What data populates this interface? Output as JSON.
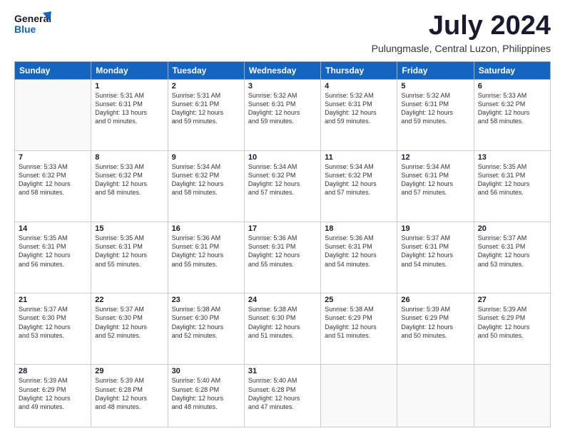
{
  "logo": {
    "line1": "General",
    "line2": "Blue"
  },
  "title": "July 2024",
  "location": "Pulungmasle, Central Luzon, Philippines",
  "weekdays": [
    "Sunday",
    "Monday",
    "Tuesday",
    "Wednesday",
    "Thursday",
    "Friday",
    "Saturday"
  ],
  "weeks": [
    [
      {
        "day": "",
        "info": ""
      },
      {
        "day": "1",
        "info": "Sunrise: 5:31 AM\nSunset: 6:31 PM\nDaylight: 13 hours\nand 0 minutes."
      },
      {
        "day": "2",
        "info": "Sunrise: 5:31 AM\nSunset: 6:31 PM\nDaylight: 12 hours\nand 59 minutes."
      },
      {
        "day": "3",
        "info": "Sunrise: 5:32 AM\nSunset: 6:31 PM\nDaylight: 12 hours\nand 59 minutes."
      },
      {
        "day": "4",
        "info": "Sunrise: 5:32 AM\nSunset: 6:31 PM\nDaylight: 12 hours\nand 59 minutes."
      },
      {
        "day": "5",
        "info": "Sunrise: 5:32 AM\nSunset: 6:31 PM\nDaylight: 12 hours\nand 59 minutes."
      },
      {
        "day": "6",
        "info": "Sunrise: 5:33 AM\nSunset: 6:32 PM\nDaylight: 12 hours\nand 58 minutes."
      }
    ],
    [
      {
        "day": "7",
        "info": "Sunrise: 5:33 AM\nSunset: 6:32 PM\nDaylight: 12 hours\nand 58 minutes."
      },
      {
        "day": "8",
        "info": "Sunrise: 5:33 AM\nSunset: 6:32 PM\nDaylight: 12 hours\nand 58 minutes."
      },
      {
        "day": "9",
        "info": "Sunrise: 5:34 AM\nSunset: 6:32 PM\nDaylight: 12 hours\nand 58 minutes."
      },
      {
        "day": "10",
        "info": "Sunrise: 5:34 AM\nSunset: 6:32 PM\nDaylight: 12 hours\nand 57 minutes."
      },
      {
        "day": "11",
        "info": "Sunrise: 5:34 AM\nSunset: 6:32 PM\nDaylight: 12 hours\nand 57 minutes."
      },
      {
        "day": "12",
        "info": "Sunrise: 5:34 AM\nSunset: 6:31 PM\nDaylight: 12 hours\nand 57 minutes."
      },
      {
        "day": "13",
        "info": "Sunrise: 5:35 AM\nSunset: 6:31 PM\nDaylight: 12 hours\nand 56 minutes."
      }
    ],
    [
      {
        "day": "14",
        "info": "Sunrise: 5:35 AM\nSunset: 6:31 PM\nDaylight: 12 hours\nand 56 minutes."
      },
      {
        "day": "15",
        "info": "Sunrise: 5:35 AM\nSunset: 6:31 PM\nDaylight: 12 hours\nand 55 minutes."
      },
      {
        "day": "16",
        "info": "Sunrise: 5:36 AM\nSunset: 6:31 PM\nDaylight: 12 hours\nand 55 minutes."
      },
      {
        "day": "17",
        "info": "Sunrise: 5:36 AM\nSunset: 6:31 PM\nDaylight: 12 hours\nand 55 minutes."
      },
      {
        "day": "18",
        "info": "Sunrise: 5:36 AM\nSunset: 6:31 PM\nDaylight: 12 hours\nand 54 minutes."
      },
      {
        "day": "19",
        "info": "Sunrise: 5:37 AM\nSunset: 6:31 PM\nDaylight: 12 hours\nand 54 minutes."
      },
      {
        "day": "20",
        "info": "Sunrise: 5:37 AM\nSunset: 6:31 PM\nDaylight: 12 hours\nand 53 minutes."
      }
    ],
    [
      {
        "day": "21",
        "info": "Sunrise: 5:37 AM\nSunset: 6:30 PM\nDaylight: 12 hours\nand 53 minutes."
      },
      {
        "day": "22",
        "info": "Sunrise: 5:37 AM\nSunset: 6:30 PM\nDaylight: 12 hours\nand 52 minutes."
      },
      {
        "day": "23",
        "info": "Sunrise: 5:38 AM\nSunset: 6:30 PM\nDaylight: 12 hours\nand 52 minutes."
      },
      {
        "day": "24",
        "info": "Sunrise: 5:38 AM\nSunset: 6:30 PM\nDaylight: 12 hours\nand 51 minutes."
      },
      {
        "day": "25",
        "info": "Sunrise: 5:38 AM\nSunset: 6:29 PM\nDaylight: 12 hours\nand 51 minutes."
      },
      {
        "day": "26",
        "info": "Sunrise: 5:39 AM\nSunset: 6:29 PM\nDaylight: 12 hours\nand 50 minutes."
      },
      {
        "day": "27",
        "info": "Sunrise: 5:39 AM\nSunset: 6:29 PM\nDaylight: 12 hours\nand 50 minutes."
      }
    ],
    [
      {
        "day": "28",
        "info": "Sunrise: 5:39 AM\nSunset: 6:29 PM\nDaylight: 12 hours\nand 49 minutes."
      },
      {
        "day": "29",
        "info": "Sunrise: 5:39 AM\nSunset: 6:28 PM\nDaylight: 12 hours\nand 48 minutes."
      },
      {
        "day": "30",
        "info": "Sunrise: 5:40 AM\nSunset: 6:28 PM\nDaylight: 12 hours\nand 48 minutes."
      },
      {
        "day": "31",
        "info": "Sunrise: 5:40 AM\nSunset: 6:28 PM\nDaylight: 12 hours\nand 47 minutes."
      },
      {
        "day": "",
        "info": ""
      },
      {
        "day": "",
        "info": ""
      },
      {
        "day": "",
        "info": ""
      }
    ]
  ]
}
